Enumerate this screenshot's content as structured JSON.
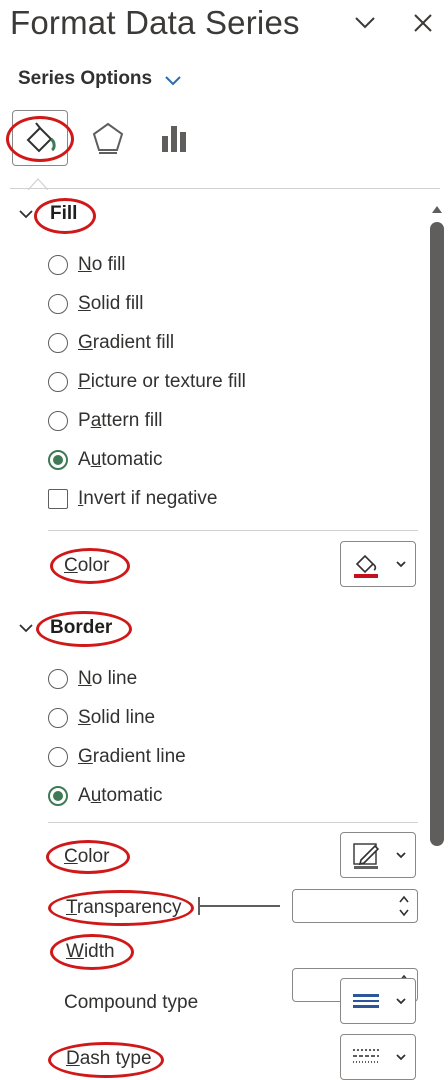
{
  "pane": {
    "title": "Format Data Series",
    "series_options_label": "Series Options"
  },
  "tabs": [
    {
      "name": "Fill & Line",
      "icon": "paint-bucket-icon"
    },
    {
      "name": "Effects",
      "icon": "pentagon-icon"
    },
    {
      "name": "Series Options",
      "icon": "bar-chart-icon"
    }
  ],
  "fill": {
    "heading": "Fill",
    "options": [
      {
        "label_key": "N",
        "label_rest": "o fill",
        "checked": false
      },
      {
        "label_key": "S",
        "label_rest": "olid fill",
        "checked": false
      },
      {
        "label_key": "G",
        "label_rest": "radient fill",
        "checked": false
      },
      {
        "label_key": "P",
        "label_rest": "icture or texture fill",
        "checked": false
      },
      {
        "label_pre": "P",
        "label_key": "a",
        "label_rest": "ttern fill",
        "checked": false
      },
      {
        "label_pre": "A",
        "label_key": "u",
        "label_rest": "tomatic",
        "checked": true
      }
    ],
    "invert": {
      "label_key": "I",
      "label_rest": "nvert if negative",
      "checked": false
    },
    "color_label_key": "C",
    "color_label_rest": "olor"
  },
  "border": {
    "heading": "Border",
    "options": [
      {
        "label_key": "N",
        "label_rest": "o line",
        "checked": false
      },
      {
        "label_key": "S",
        "label_rest": "olid line",
        "checked": false
      },
      {
        "label_key": "G",
        "label_rest": "radient line",
        "checked": false
      },
      {
        "label_pre": "A",
        "label_key": "u",
        "label_rest": "tomatic",
        "checked": true
      }
    ],
    "color_label_key": "C",
    "color_label_rest": "olor",
    "transparency_label_key": "T",
    "transparency_label_rest": "ransparency",
    "transparency_value": "",
    "width_label_key": "W",
    "width_label_rest": "idth",
    "width_value": "",
    "compound_label": "Compound type",
    "dash_label_key": "D",
    "dash_label_rest": "ash type"
  },
  "colors": {
    "accent_green": "#3f7a56",
    "annotation_red": "#d01818",
    "fill_swatch_red": "#c50f1f"
  }
}
